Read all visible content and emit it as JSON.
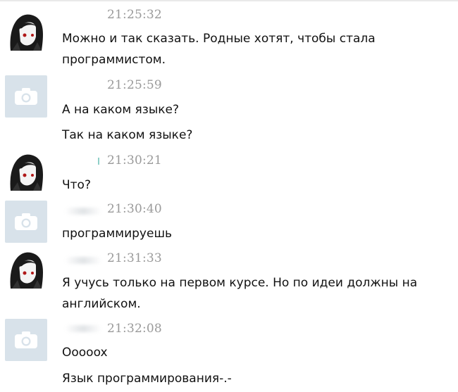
{
  "messages": [
    {
      "avatar": "anime-girl-avatar",
      "time": "21:25:32",
      "lines": [
        "Можно и так сказать. Родные хотят, чтобы стала",
        "программистом."
      ]
    },
    {
      "avatar": "camera-placeholder-avatar",
      "time": "21:25:59",
      "lines": [
        "А на каком языке?",
        "Так на каком языке?"
      ]
    },
    {
      "avatar": "anime-girl-avatar",
      "time": "21:30:21",
      "lines": [
        "Что?"
      ]
    },
    {
      "avatar": "camera-placeholder-avatar",
      "time": "21:30:40",
      "lines": [
        "программируешь"
      ]
    },
    {
      "avatar": "anime-girl-avatar",
      "time": "21:31:33",
      "lines": [
        "Я учусь только на первом курсе. Но по идеи должны на",
        "английском."
      ]
    },
    {
      "avatar": "camera-placeholder-avatar",
      "time": "21:32:08",
      "lines": [
        "Ooooox",
        "Язык программирования-.-"
      ]
    }
  ],
  "colors": {
    "placeholder_bg": "#d8e2ea",
    "camera": "#ffffff",
    "time": "#9a9a9a"
  }
}
